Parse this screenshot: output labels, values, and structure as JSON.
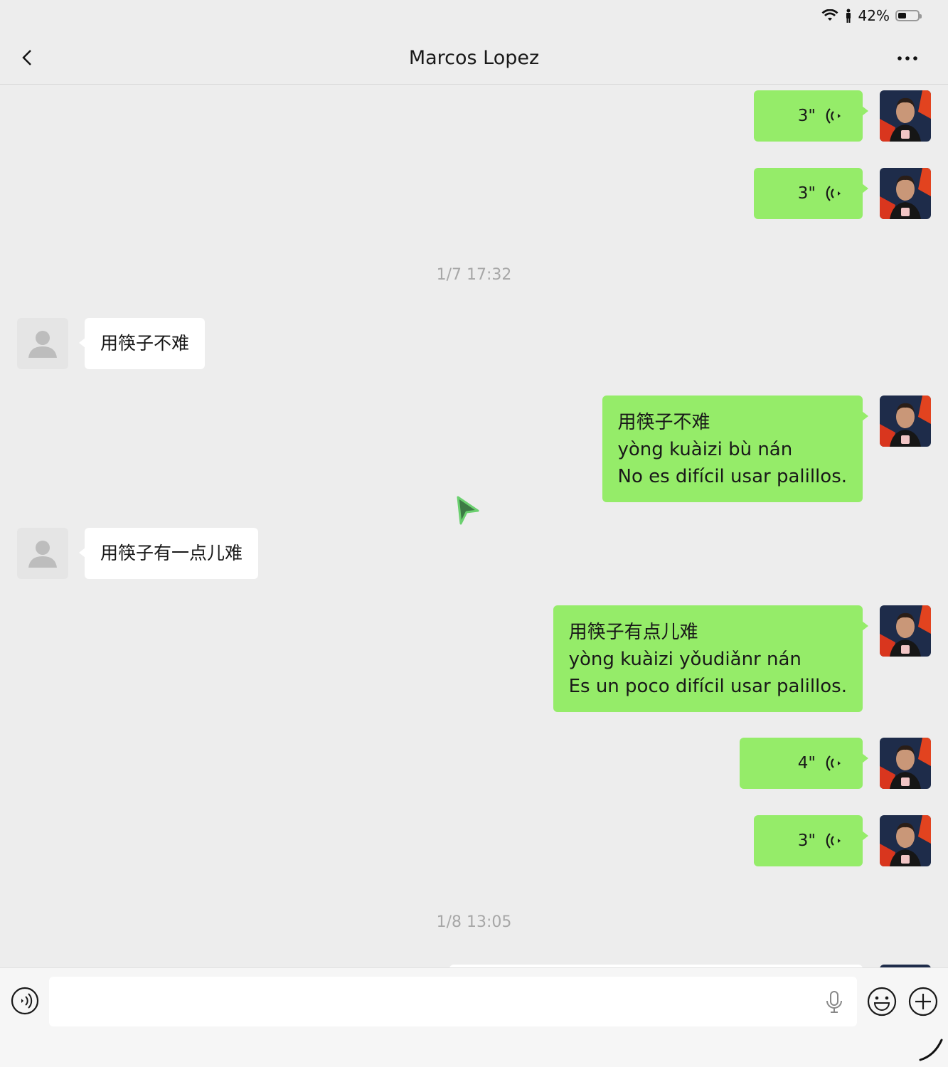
{
  "status": {
    "battery": "42%",
    "battery_level": 0.42
  },
  "header": {
    "title": "Marcos Lopez"
  },
  "messages": [
    {
      "type": "voice",
      "duration": "3\""
    },
    {
      "type": "voice",
      "duration": "3\""
    },
    {
      "type": "timestamp",
      "text": "1/7 17:32"
    },
    {
      "type": "text_in",
      "text": "用筷子不难"
    },
    {
      "type": "text_out",
      "lines": [
        "用筷子不难",
        "yòng kuàizi bù nán",
        "No es difícil usar palillos."
      ]
    },
    {
      "type": "text_in",
      "text": "用筷子有一点儿难"
    },
    {
      "type": "text_out",
      "lines": [
        "用筷子有点儿难",
        "yòng kuàizi yǒudiǎnr nán",
        "Es un poco difícil usar palillos."
      ]
    },
    {
      "type": "voice",
      "duration": "4\""
    },
    {
      "type": "voice",
      "duration": "3\""
    },
    {
      "type": "timestamp",
      "text": "1/8 13:05"
    }
  ],
  "icons": {
    "back": "chevron-left-icon",
    "more": "more-icon",
    "voice": "voice-wave-icon",
    "mic": "microphone-icon",
    "emoji": "emoji-icon",
    "plus": "plus-icon"
  },
  "colors": {
    "bubble_out": "#95ec69",
    "bubble_in": "#ffffff",
    "background": "#ededed"
  }
}
